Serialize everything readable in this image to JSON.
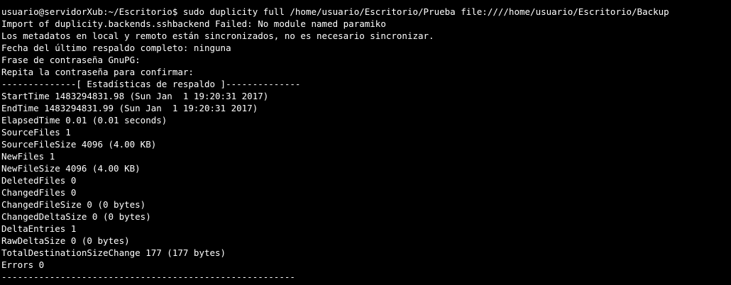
{
  "terminal": {
    "lines": [
      "usuario@servidorXub:~/Escritorio$ sudo duplicity full /home/usuario/Escritorio/Prueba file:////home/usuario/Escritorio/Backup",
      "Import of duplicity.backends.sshbackend Failed: No module named paramiko",
      "Los metadatos en local y remoto están sincronizados, no es necesario sincronizar.",
      "Fecha del último respaldo completo: ninguna",
      "Frase de contraseña GnuPG:",
      "Repita la contraseña para confirmar:",
      "--------------[ Estadísticas de respaldo ]--------------",
      "StartTime 1483294831.98 (Sun Jan  1 19:20:31 2017)",
      "EndTime 1483294831.99 (Sun Jan  1 19:20:31 2017)",
      "ElapsedTime 0.01 (0.01 seconds)",
      "SourceFiles 1",
      "SourceFileSize 4096 (4.00 KB)",
      "NewFiles 1",
      "NewFileSize 4096 (4.00 KB)",
      "DeletedFiles 0",
      "ChangedFiles 0",
      "ChangedFileSize 0 (0 bytes)",
      "ChangedDeltaSize 0 (0 bytes)",
      "DeltaEntries 1",
      "RawDeltaSize 0 (0 bytes)",
      "TotalDestinationSizeChange 177 (177 bytes)",
      "Errors 0",
      "-------------------------------------------------------"
    ],
    "colors": {
      "background": "#000000",
      "foreground": "#ffffff"
    }
  }
}
